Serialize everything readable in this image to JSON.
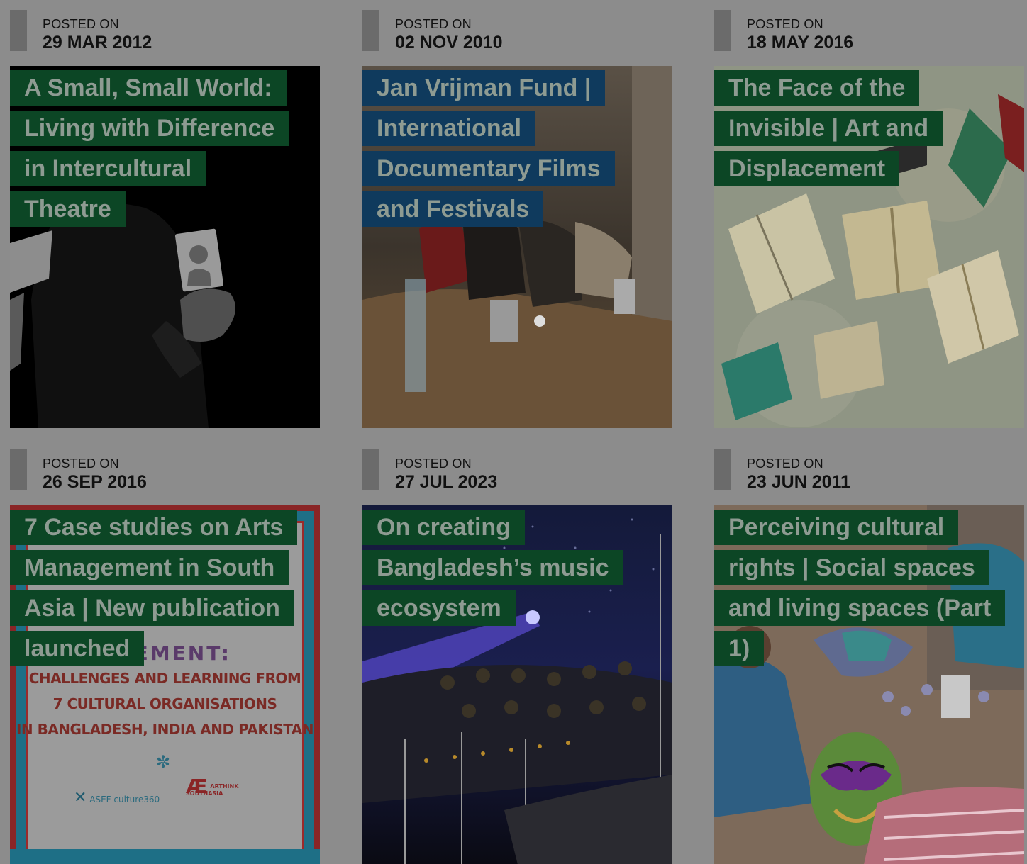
{
  "posts": [
    {
      "posted_label": "POSTED ON",
      "date": "29 MAR 2012",
      "title": "A Small, Small World: Living with Difference in Intercultural Theatre",
      "label_color": "#0c4625"
    },
    {
      "posted_label": "POSTED ON",
      "date": "02 NOV 2010",
      "title": "Jan Vrijman Fund | International Documentary Films and Festivals",
      "label_color": "#0f3a5d"
    },
    {
      "posted_label": "POSTED ON",
      "date": "18 MAY 2016",
      "title": "The Face of the Invisible | Art and Displacement",
      "label_color": "#0c4625"
    },
    {
      "posted_label": "POSTED ON",
      "date": "26 SEP 2016",
      "title": "7 Case studies on Arts Management in South Asia | New publication launched",
      "label_color": "#0c4625",
      "image_text": {
        "headline": "AGEMENT:",
        "line1": "CHALLENGES AND LEARNING FROM",
        "line2": "7 CULTURAL ORGANISATIONS",
        "line3": "IN BANGLADESH, INDIA AND PAKISTAN",
        "logo_asef": "ASEF culture360",
        "logo_arthink": "ARTHINK SOUTHASIA"
      }
    },
    {
      "posted_label": "POSTED ON",
      "date": "27 JUL 2023",
      "title": "On creating Bangladesh’s music ecosystem",
      "label_color": "#0c4625"
    },
    {
      "posted_label": "POSTED ON",
      "date": "23 JUN 2011",
      "title": "Perceiving cultural rights | Social spaces and living spaces (Part 1)",
      "label_color": "#0c4625"
    }
  ]
}
